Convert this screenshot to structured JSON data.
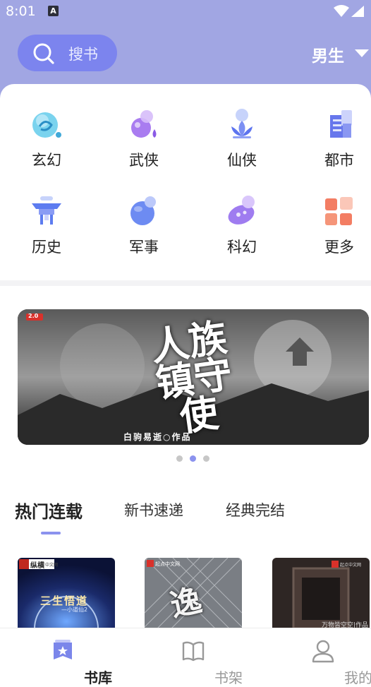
{
  "status_bar": {
    "time": "8:01",
    "notif_letter": "A"
  },
  "header": {
    "search_placeholder": "搜书",
    "gender_label": "男生"
  },
  "categories": [
    {
      "label": "玄幻",
      "icon": "swirl-icon"
    },
    {
      "label": "武侠",
      "icon": "gourd-icon"
    },
    {
      "label": "仙侠",
      "icon": "lotus-icon"
    },
    {
      "label": "都市",
      "icon": "building-icon"
    },
    {
      "label": "历史",
      "icon": "palace-icon"
    },
    {
      "label": "军事",
      "icon": "grenade-icon"
    },
    {
      "label": "科幻",
      "icon": "ufo-icon"
    },
    {
      "label": "更多",
      "icon": "grid-icon"
    }
  ],
  "banner": {
    "badge": "2.0",
    "title": "人族镇守使",
    "author": "白驹易逝○作品"
  },
  "carousel": {
    "count": 3,
    "active": 1
  },
  "tabs": [
    {
      "label": "热门连载",
      "active": true
    },
    {
      "label": "新书速递",
      "active": false
    },
    {
      "label": "经典完结",
      "active": false
    }
  ],
  "books": [
    {
      "publisher": "纵横",
      "publisher_sub": "中文网",
      "title": "三生悟道",
      "author": "—小道仙2"
    },
    {
      "publisher": "起点中文网",
      "title": "逸"
    },
    {
      "publisher": "起点中文网",
      "caption": "万物皆空空|作品"
    }
  ],
  "bottom_nav": [
    {
      "label": "书库",
      "active": true
    },
    {
      "label": "书架",
      "active": false
    },
    {
      "label": "我的",
      "active": false
    }
  ],
  "colors": {
    "header_bg": "#a1a6e3",
    "search_bg": "#7c84ee",
    "accent": "#8b92ee"
  }
}
